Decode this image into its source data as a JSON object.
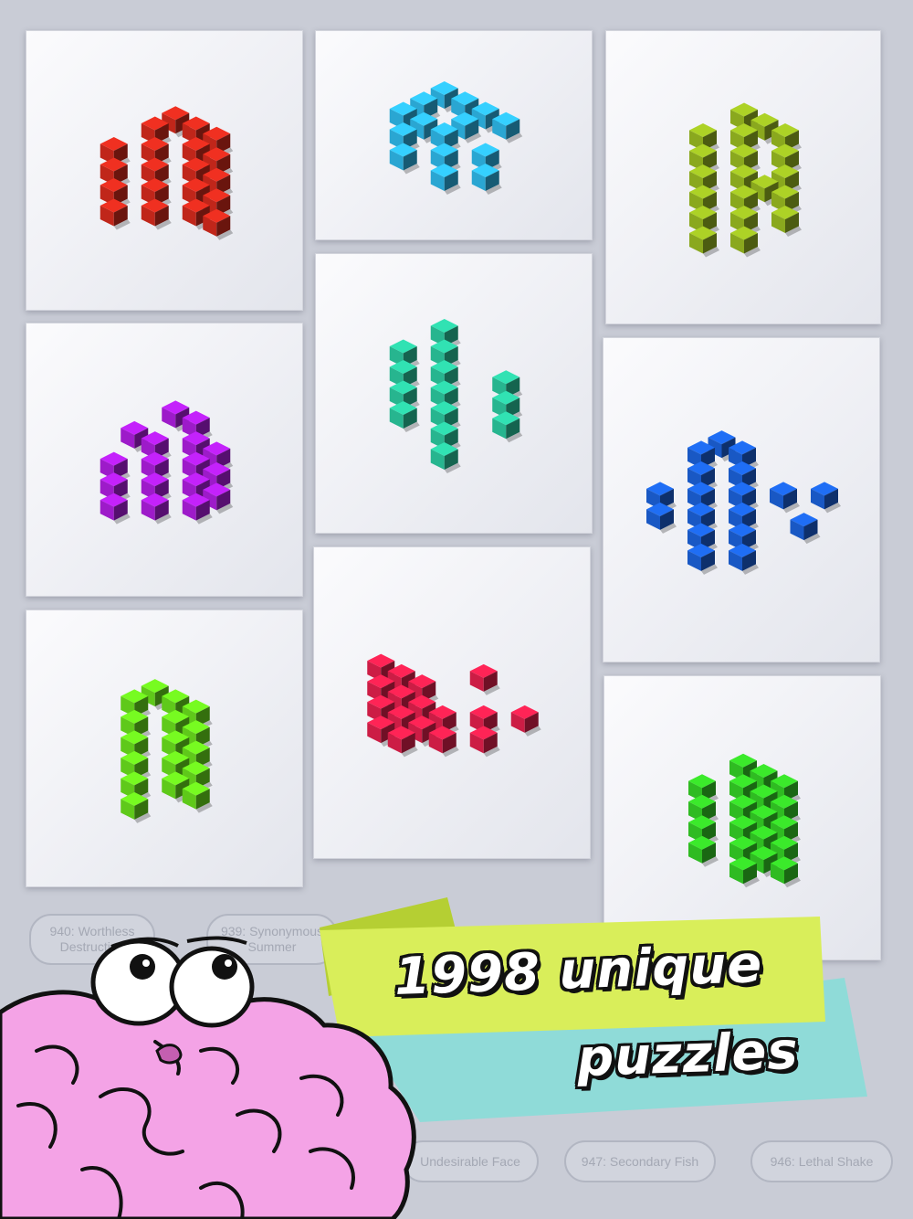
{
  "background_nodes": [
    {
      "label": "940: Worthless Destruction"
    },
    {
      "label": "939: Synonymous Summer"
    },
    {
      "label": "Undesirable Face"
    },
    {
      "label": "947: Secondary Fish"
    },
    {
      "label": "946: Lethal Shake"
    }
  ],
  "puzzle_cards": [
    {
      "color": "#c0261a",
      "name": "red-puzzle"
    },
    {
      "color": "#2aa6d2",
      "name": "cyan-puzzle"
    },
    {
      "color": "#8aa81e",
      "name": "olive-puzzle"
    },
    {
      "color": "#9d1bc9",
      "name": "purple-puzzle"
    },
    {
      "color": "#27b58f",
      "name": "teal-puzzle"
    },
    {
      "color": "#1958c4",
      "name": "blue-puzzle"
    },
    {
      "color": "#5fc91a",
      "name": "lime-puzzle"
    },
    {
      "color": "#cc1d45",
      "name": "crimson-puzzle"
    },
    {
      "color": "#2fbb22",
      "name": "green-puzzle"
    }
  ],
  "banner": {
    "line1": "1998 unique",
    "line2": "puzzles",
    "front_color": "#d9ee5a",
    "back_color": "#8fdbd8"
  },
  "mascot": {
    "icon": "brain-mascot-icon",
    "color": "#f4a3e6"
  }
}
